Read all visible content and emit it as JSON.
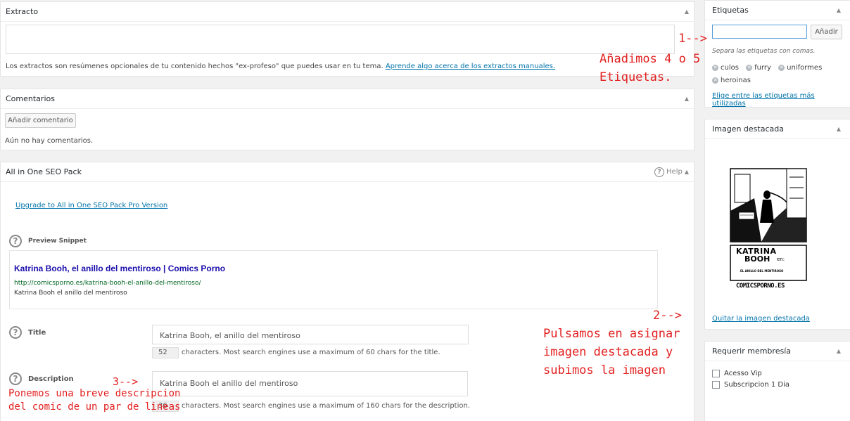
{
  "excerpt": {
    "title": "Extracto",
    "help_text": "Los extractos son resúmenes opcionales de tu contenido hechos \"ex-profeso\" que puedes usar en tu tema.",
    "help_link": "Aprende algo acerca de los extractos manuales."
  },
  "comments": {
    "title": "Comentarios",
    "add_button": "Añadir comentario",
    "empty_text": "Aún no hay comentarios."
  },
  "seo": {
    "title": "All in One SEO Pack",
    "help_label": "Help",
    "upgrade_link": "Upgrade to All in One SEO Pack Pro Version",
    "preview_label": "Preview Snippet",
    "snippet": {
      "title": "Katrina Booh, el anillo del mentiroso | Comics Porno",
      "url": "http://comicsporno.es/katrina-booh-el-anillo-del-mentiroso/",
      "description": "Katrina Booh el anillo del mentiroso"
    },
    "title_field": {
      "label": "Title",
      "value": "Katrina Booh, el anillo del mentiroso",
      "count": "52",
      "note": "characters. Most search engines use a maximum of 60 chars for the title."
    },
    "description_field": {
      "label": "Description",
      "value": "Katrina Booh el anillo del mentiroso",
      "count": "36",
      "note": "characters. Most search engines use a maximum of 160 chars for the description."
    }
  },
  "tags": {
    "title": "Etiquetas",
    "add_button": "Añadir",
    "hint": "Separa las etiquetas con comas.",
    "items": [
      "culos",
      "furry",
      "uniformes",
      "heroinas"
    ],
    "choose_link": "Elige entre las etiquetas más utilizadas"
  },
  "featured": {
    "title": "Imagen destacada",
    "image_text": {
      "title_line1": "KATRINA",
      "title_line2": "BOOH",
      "en": "en:",
      "subtitle": "EL ANILLO DEL MENTIROSO",
      "site": "COMICSPORNO.ES"
    },
    "remove_link": "Quitar la imagen destacada"
  },
  "membership": {
    "title": "Requerir membresía",
    "options": [
      "Acesso Vip",
      "Subscripcion 1 Dia"
    ]
  },
  "annotations": {
    "a1_arrow": "1-->",
    "a1_line1": "Añadimos 4 o 5",
    "a1_line2": "Etiquetas.",
    "a2_arrow": "2-->",
    "a2_line1": "Pulsamos en asignar",
    "a2_line2": "imagen destacada y",
    "a2_line3": "subimos la imagen",
    "a3_arrow": "3-->",
    "a3_line1": "Ponemos una breve descripcion",
    "a3_line2": "del comic de un par de lineas"
  },
  "colors": {
    "link": "#0073aa",
    "snippet_title": "#1a0dab",
    "snippet_url": "#006621",
    "annotation": "#e32020"
  }
}
